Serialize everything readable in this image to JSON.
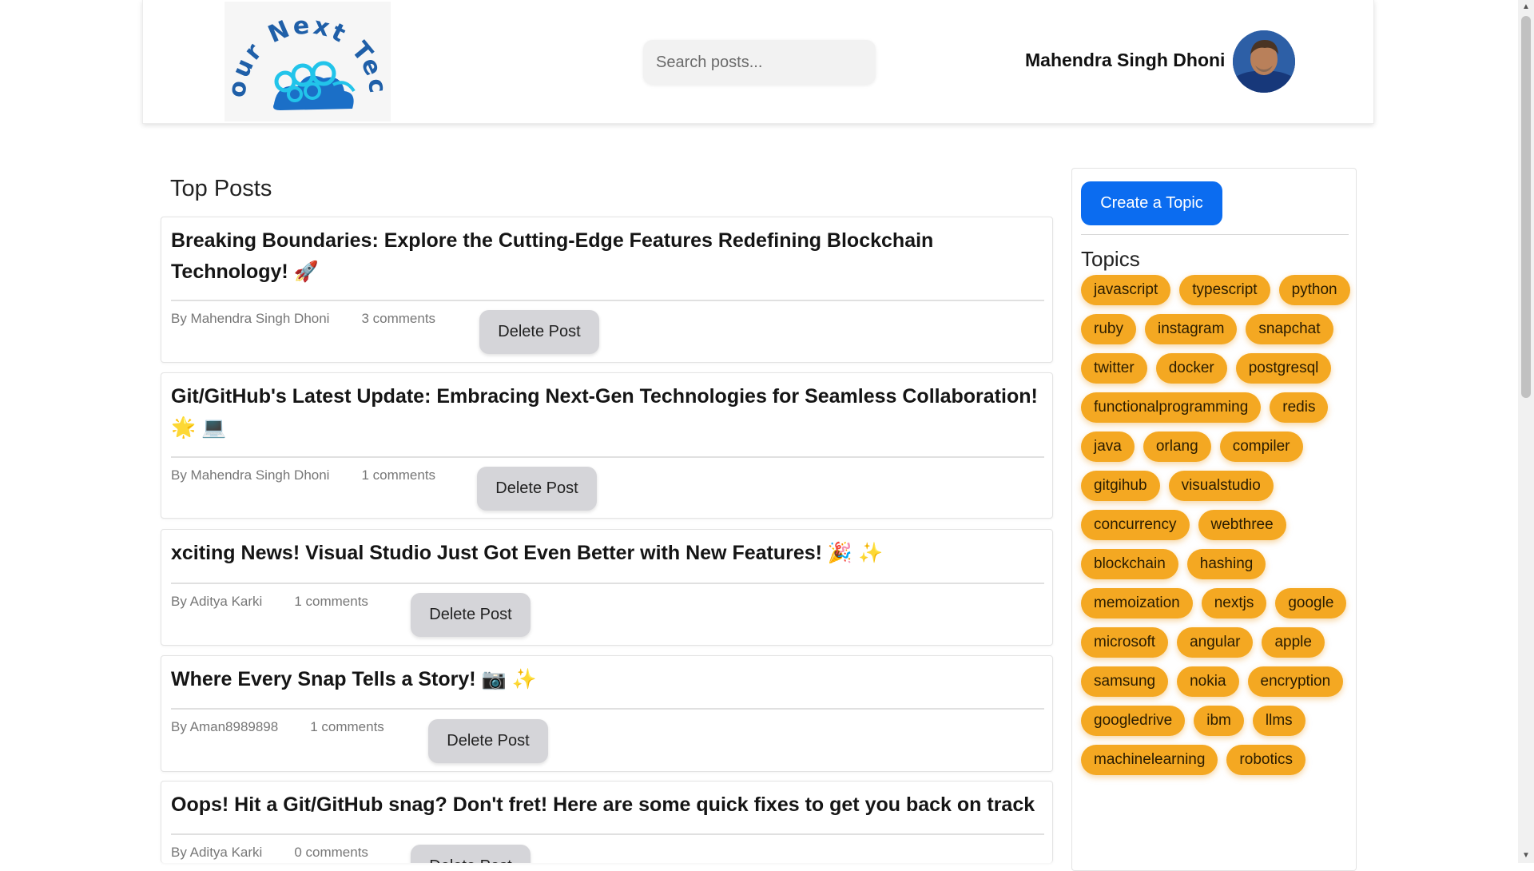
{
  "header": {
    "logo_text": "Your Next Tech",
    "search_placeholder": "Search posts...",
    "user_name": "Mahendra Singh Dhoni"
  },
  "main": {
    "section_title": "Top Posts",
    "posts": [
      {
        "title": "Breaking Boundaries: Explore the Cutting-Edge Features Redefining Blockchain Technology! 🚀",
        "author": "By Mahendra Singh Dhoni",
        "comments": "3 comments",
        "delete_label": "Delete Post"
      },
      {
        "title": "Git/GitHub's Latest Update: Embracing Next-Gen Technologies for Seamless Collaboration! 🌟 💻",
        "author": "By Mahendra Singh Dhoni",
        "comments": "1 comments",
        "delete_label": "Delete Post"
      },
      {
        "title": "xciting News! Visual Studio Just Got Even Better with New Features! 🎉 ✨",
        "author": "By Aditya Karki",
        "comments": "1 comments",
        "delete_label": "Delete Post"
      },
      {
        "title": "Where Every Snap Tells a Story! 📷 ✨",
        "author": "By Aman8989898",
        "comments": "1 comments",
        "delete_label": "Delete Post"
      },
      {
        "title": "Oops! Hit a Git/GitHub snag? Don't fret! Here are some quick fixes to get you back on track",
        "author": "By Aditya Karki",
        "comments": "0 comments",
        "delete_label": "Delete Post"
      }
    ]
  },
  "sidebar": {
    "create_label": "Create a Topic",
    "topics_title": "Topics",
    "topics": [
      "javascript",
      "typescript",
      "python",
      "ruby",
      "instagram",
      "snapchat",
      "twitter",
      "docker",
      "postgresql",
      "functionalprogramming",
      "redis",
      "java",
      "orlang",
      "compiler",
      "gitgihub",
      "visualstudio",
      "concurrency",
      "webthree",
      "blockchain",
      "hashing",
      "memoization",
      "nextjs",
      "google",
      "microsoft",
      "angular",
      "apple",
      "samsung",
      "nokia",
      "encryption",
      "googledrive",
      "ibm",
      "llms",
      "machinelearning",
      "robotics"
    ]
  },
  "colors": {
    "primary_button": "#0b6cf0",
    "topic_tag": "#f4a822",
    "delete_button": "#d5d5d9"
  }
}
